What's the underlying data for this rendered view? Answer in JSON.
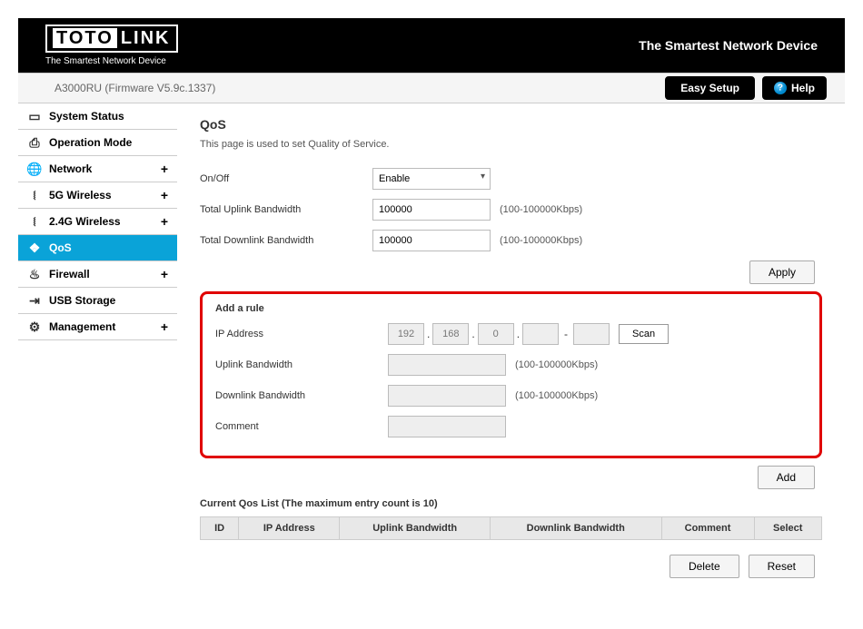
{
  "header": {
    "brand_boxed": "TOTO",
    "brand_rest": "LINK",
    "brand_sub": "The Smartest Network Device",
    "tagline": "The Smartest Network Device"
  },
  "subheader": {
    "model": "A3000RU (Firmware V5.9c.1337)",
    "easy_setup": "Easy Setup",
    "help": "Help"
  },
  "nav": {
    "items": [
      {
        "label": "System Status",
        "icon": "💬",
        "expandable": false
      },
      {
        "label": "Operation Mode",
        "icon": "🖶",
        "expandable": false
      },
      {
        "label": "Network",
        "icon": "🌐",
        "expandable": true
      },
      {
        "label": "5G Wireless",
        "icon": "📶",
        "expandable": true
      },
      {
        "label": "2.4G Wireless",
        "icon": "📶",
        "expandable": true
      },
      {
        "label": "QoS",
        "icon": "❖",
        "expandable": false,
        "active": true
      },
      {
        "label": "Firewall",
        "icon": "🔥",
        "expandable": true
      },
      {
        "label": "USB Storage",
        "icon": "⇥",
        "expandable": false
      },
      {
        "label": "Management",
        "icon": "⚙",
        "expandable": true
      }
    ]
  },
  "qos": {
    "title": "QoS",
    "desc": "This page is used to set Quality of Service.",
    "onoff_label": "On/Off",
    "onoff_value": "Enable",
    "uplink_label": "Total Uplink Bandwidth",
    "uplink_value": "100000",
    "downlink_label": "Total Downlink Bandwidth",
    "downlink_value": "100000",
    "bw_hint": "(100-100000Kbps)",
    "apply": "Apply"
  },
  "rule": {
    "title": "Add a rule",
    "ip_label": "IP Address",
    "ip": {
      "a": "192",
      "b": "168",
      "c": "0",
      "d": "",
      "e": ""
    },
    "scan": "Scan",
    "uplink_label": "Uplink Bandwidth",
    "downlink_label": "Downlink Bandwidth",
    "comment_label": "Comment",
    "bw_hint": "(100-100000Kbps)",
    "add": "Add"
  },
  "list": {
    "title": "Current Qos List  (The maximum entry count is 10)",
    "cols": {
      "id": "ID",
      "ip": "IP Address",
      "up": "Uplink Bandwidth",
      "down": "Downlink Bandwidth",
      "comment": "Comment",
      "select": "Select"
    },
    "delete": "Delete",
    "reset": "Reset"
  }
}
